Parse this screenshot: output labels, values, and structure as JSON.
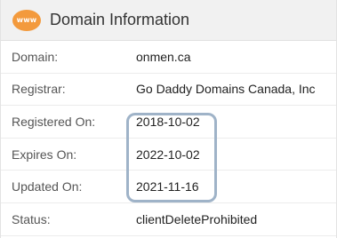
{
  "header": {
    "icon": "www-globe-icon",
    "icon_text": "www",
    "title": "Domain Information",
    "accent_color": "#f39a3d"
  },
  "rows": [
    {
      "label": "Domain:",
      "value": "onmen.ca"
    },
    {
      "label": "Registrar:",
      "value": "Go Daddy Domains Canada, Inc"
    },
    {
      "label": "Registered On:",
      "value": "2018-10-02"
    },
    {
      "label": "Expires On:",
      "value": "2022-10-02"
    },
    {
      "label": "Updated On:",
      "value": "2021-11-16"
    },
    {
      "label": "Status:",
      "value": "clientDeleteProhibited"
    }
  ],
  "highlight": {
    "color": "#9fb3c8",
    "covers": [
      "Registered On",
      "Expires On",
      "Updated On"
    ]
  }
}
